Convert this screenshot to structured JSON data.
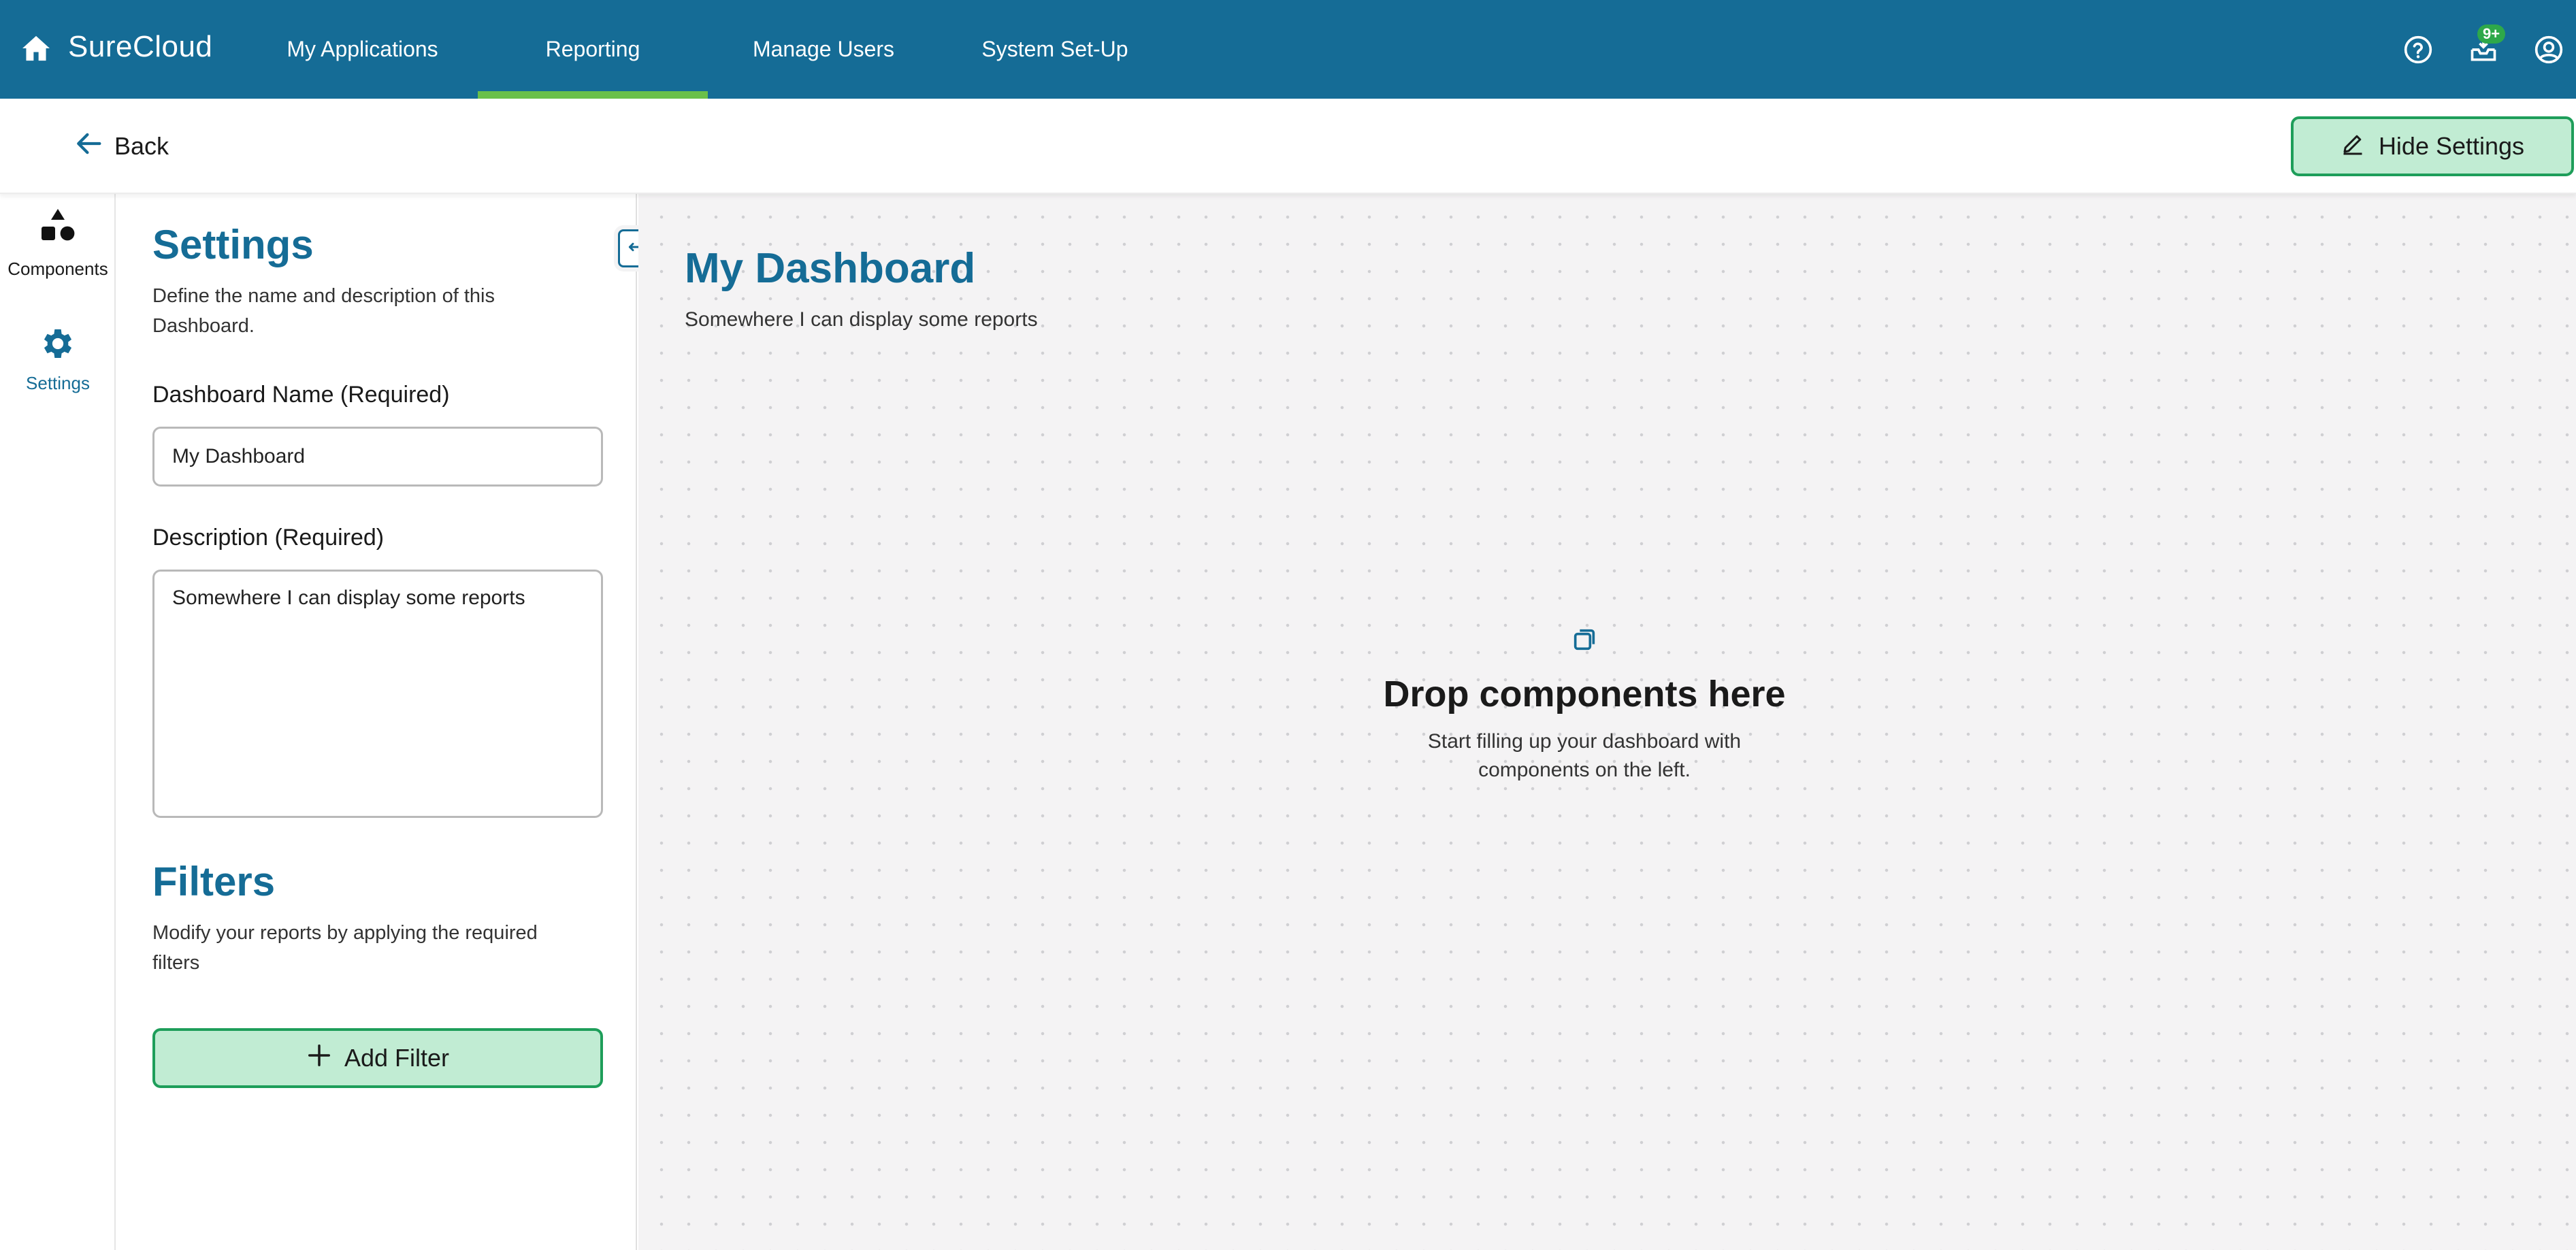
{
  "header": {
    "brand": "SureCloud",
    "nav": [
      {
        "label": "My Applications"
      },
      {
        "label": "Reporting",
        "active": true
      },
      {
        "label": "Manage Users"
      },
      {
        "label": "System Set-Up"
      }
    ],
    "notification_badge": "9+",
    "icons": [
      "home-icon",
      "help-icon",
      "inbox-icon",
      "account-icon"
    ]
  },
  "subbar": {
    "back_label": "Back",
    "hide_settings_label": "Hide Settings"
  },
  "rail": {
    "items": [
      {
        "label": "Components",
        "icon": "components-icon"
      },
      {
        "label": "Settings",
        "icon": "gear-icon",
        "active": true
      }
    ]
  },
  "settings": {
    "title": "Settings",
    "description": "Define the name and description of this Dashboard.",
    "name_label": "Dashboard Name (Required)",
    "name_value": "My Dashboard",
    "desc_label": "Description (Required)",
    "desc_value": "Somewhere I can display some reports",
    "filters_title": "Filters",
    "filters_description": "Modify your reports by applying the required filters",
    "add_filter_label": "Add Filter"
  },
  "canvas": {
    "title": "My Dashboard",
    "description": "Somewhere I can display some reports",
    "drop_title": "Drop components here",
    "drop_subtitle": "Start filling up your dashboard with components on the left."
  },
  "colors": {
    "primary": "#156c96",
    "accent": "#6ac04a",
    "button_bg": "#c1ecd3",
    "button_border": "#1e9e5a",
    "canvas_bg": "#f4f3f4"
  }
}
